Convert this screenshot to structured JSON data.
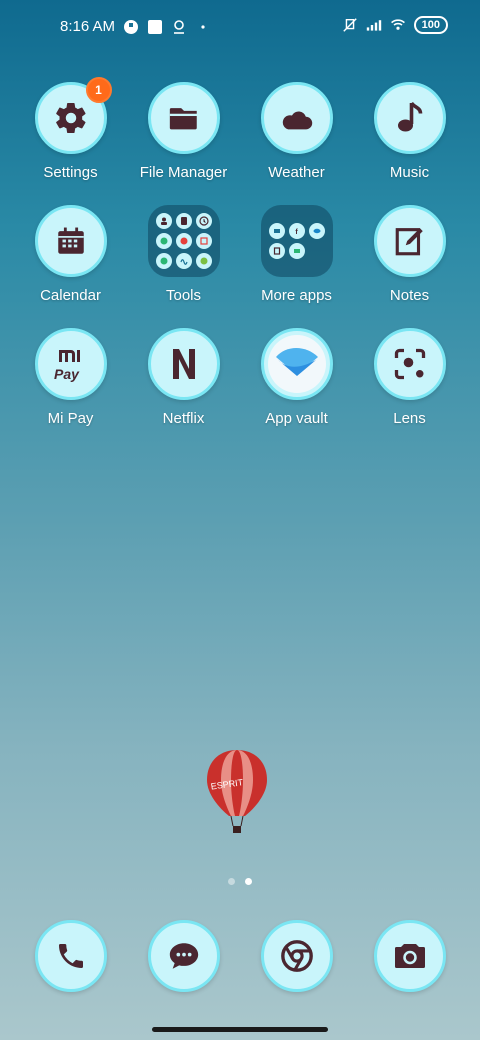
{
  "status": {
    "time": "8:16 AM",
    "battery": "100"
  },
  "apps": [
    {
      "label": "Settings",
      "badge": "1"
    },
    {
      "label": "File Manager"
    },
    {
      "label": "Weather"
    },
    {
      "label": "Music"
    },
    {
      "label": "Calendar"
    },
    {
      "label": "Tools"
    },
    {
      "label": "More apps"
    },
    {
      "label": "Notes"
    },
    {
      "label": "Mi Pay"
    },
    {
      "label": "Netflix"
    },
    {
      "label": "App vault"
    },
    {
      "label": "Lens"
    }
  ],
  "wallpaper": {
    "balloon_text": "ESPRIT"
  },
  "pages": {
    "count": 2,
    "current": 2
  },
  "colors": {
    "icon_bg": "#c9f5fb",
    "icon_border": "#7ae6f3",
    "glyph": "#4a2630",
    "badge": "#ff6a1a"
  }
}
